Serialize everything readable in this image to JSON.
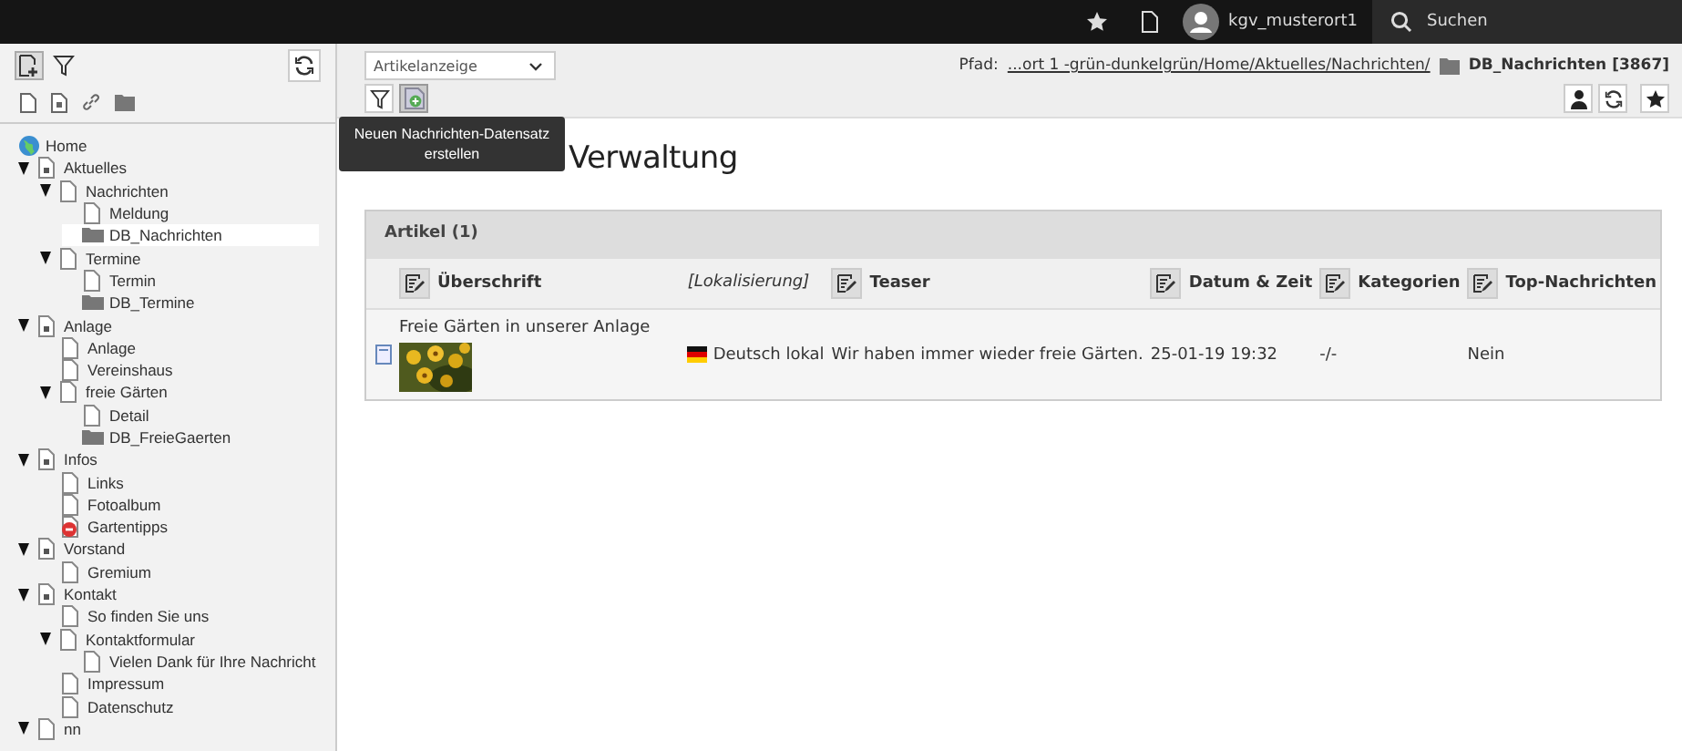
{
  "topbar": {
    "user": "kgv_musterort1",
    "search": {
      "placeholder": "Suchen"
    }
  },
  "tree": {
    "root": {
      "label": "Home",
      "kind": "home",
      "selected": false
    },
    "items": [
      {
        "label": "Aktuelles",
        "kind": "shortcut",
        "expanded": true,
        "selected": false,
        "children": [
          {
            "label": "Nachrichten",
            "kind": "page",
            "expanded": true,
            "selected": false,
            "children": [
              {
                "label": "Meldung",
                "kind": "page",
                "selected": false
              },
              {
                "label": "DB_Nachrichten",
                "kind": "folder",
                "selected": true
              }
            ]
          },
          {
            "label": "Termine",
            "kind": "page",
            "expanded": true,
            "selected": false,
            "children": [
              {
                "label": "Termin",
                "kind": "page",
                "selected": false
              },
              {
                "label": "DB_Termine",
                "kind": "folder",
                "selected": false
              }
            ]
          }
        ]
      },
      {
        "label": "Anlage",
        "kind": "shortcut",
        "expanded": true,
        "selected": false,
        "children": [
          {
            "label": "Anlage",
            "kind": "page",
            "selected": false
          },
          {
            "label": "Vereinshaus",
            "kind": "page",
            "selected": false
          },
          {
            "label": "freie Gärten",
            "kind": "page",
            "expanded": true,
            "selected": false,
            "children": [
              {
                "label": "Detail",
                "kind": "page",
                "selected": false
              },
              {
                "label": "DB_FreieGaerten",
                "kind": "folder",
                "selected": false
              }
            ]
          }
        ]
      },
      {
        "label": "Infos",
        "kind": "shortcut",
        "expanded": true,
        "selected": false,
        "children": [
          {
            "label": "Links",
            "kind": "page",
            "selected": false
          },
          {
            "label": "Fotoalbum",
            "kind": "page",
            "selected": false
          },
          {
            "label": "Gartentipps",
            "kind": "hidden",
            "selected": false
          }
        ]
      },
      {
        "label": "Vorstand",
        "kind": "shortcut",
        "expanded": true,
        "selected": false,
        "children": [
          {
            "label": "Gremium",
            "kind": "page",
            "selected": false
          }
        ]
      },
      {
        "label": "Kontakt",
        "kind": "shortcut",
        "expanded": true,
        "selected": false,
        "children": [
          {
            "label": "So finden Sie uns",
            "kind": "page",
            "selected": false
          },
          {
            "label": "Kontaktformular",
            "kind": "page",
            "expanded": true,
            "selected": false,
            "children": [
              {
                "label": "Vielen Dank für Ihre Nachricht",
                "kind": "page",
                "selected": false
              }
            ]
          },
          {
            "label": "Impressum",
            "kind": "page",
            "selected": false
          },
          {
            "label": "Datenschutz",
            "kind": "page",
            "selected": false
          }
        ]
      },
      {
        "label": "nn",
        "kind": "page",
        "expanded": true,
        "selected": false
      }
    ]
  },
  "docheader": {
    "view_select": "Artikelanzeige",
    "path_label": "Pfad:",
    "path": "...ort 1 -grün-dunkelgrün/Home/Aktuelles/Nachrichten/",
    "page": "DB_Nachrichten [3867]"
  },
  "tooltip": "Neuen Nachrichten-Datensatz erstellen",
  "heading": "Verwaltung",
  "table": {
    "title": "Artikel (1)",
    "columns": [
      {
        "label": "Überschrift",
        "kind": "editable"
      },
      {
        "label": "[Lokalisierung]",
        "kind": "plain"
      },
      {
        "label": "Teaser",
        "kind": "editable"
      },
      {
        "label": "Datum & Zeit",
        "kind": "editable"
      },
      {
        "label": "Kategorien",
        "kind": "editable"
      },
      {
        "label": "Top-Nachrichten",
        "kind": "editable"
      }
    ],
    "rows": [
      {
        "title": "Freie Gärten in unserer Anlage",
        "language": "Deutsch lokal",
        "teaser": "Wir haben immer wieder freie Gärten.",
        "date": "25-01-19 19:32",
        "categories": "-/-",
        "top": "Nein"
      }
    ]
  }
}
